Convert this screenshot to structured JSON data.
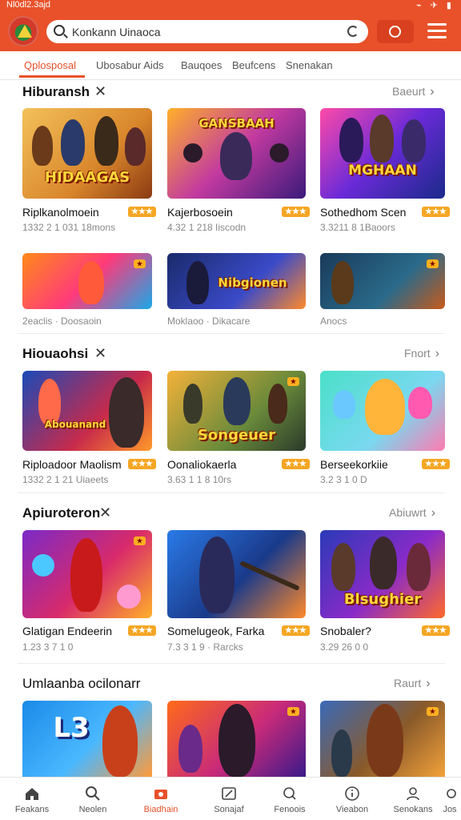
{
  "status": {
    "time": "Nl0dl2.3ajd",
    "icons": "⌁ ✈ ▮"
  },
  "search": {
    "value": "Konkann Uinaoca"
  },
  "tabs": [
    "Qplosposal",
    "Ubosabur Aids",
    "Bauqoes",
    "Beufcens",
    "Snenakan"
  ],
  "sections": [
    {
      "title": "Hiburansh",
      "see_all": "Baeurt",
      "games": [
        {
          "name": "Riplkanolmoein",
          "meta": "1332 2 1 031 18mons",
          "rating": "★★★",
          "art": "HIDAAGAS"
        },
        {
          "name": "Kajerbosoein",
          "meta": "4.32 1 218 Iiscodn",
          "rating": "★★★",
          "art": "GANSBAAH"
        },
        {
          "name": "Sothedhom Scen",
          "meta": "3.3211 8 1Baoors",
          "rating": "★★★",
          "art": "MGHAAN"
        },
        {
          "name": "",
          "meta": "2eaclis · Doosaoin",
          "rating": "",
          "art": ""
        },
        {
          "name": "",
          "meta": "Moklaoo · Dikacare",
          "rating": "",
          "art": "Nibgionen"
        },
        {
          "name": "",
          "meta": "Anocs",
          "rating": "",
          "art": ""
        }
      ]
    },
    {
      "title": "Hiouaohsi",
      "see_all": "Fnort",
      "games": [
        {
          "name": "Riploadoor Maolism",
          "meta": "1332 2 1 21 Uiaeets",
          "rating": "★★★",
          "art": "Abouanand"
        },
        {
          "name": "Oonaliokaerla",
          "meta": "3.63 1 1 8 10rs",
          "rating": "★★★",
          "art": "Songeuer"
        },
        {
          "name": "Berseekorkiie",
          "meta": "3.2 3 1 0 D",
          "rating": "★★★",
          "art": ""
        }
      ]
    },
    {
      "title": "Apiuroteron",
      "see_all": "Abiuwrt",
      "games": [
        {
          "name": "Glatigan Endeerin",
          "meta": "1.23 3 7 1 0",
          "rating": "★★★",
          "art": ""
        },
        {
          "name": "Somelugeok, Farka",
          "meta": "7.3 3 1 9 · Rarcks",
          "rating": "★★★",
          "art": ""
        },
        {
          "name": "Snobaler?",
          "meta": "3.29 26 0 0",
          "rating": "★★★",
          "art": "Blsughier"
        }
      ]
    },
    {
      "title": "Umlaanba ocilonarr",
      "see_all": "Raurt",
      "games": [
        {
          "name": "",
          "meta": "",
          "rating": "",
          "art": "L3"
        },
        {
          "name": "",
          "meta": "",
          "rating": "",
          "art": ""
        },
        {
          "name": "",
          "meta": "",
          "rating": "",
          "art": ""
        }
      ]
    }
  ],
  "bottom_nav": [
    {
      "label": "Feakans",
      "icon": "home-icon"
    },
    {
      "label": "Neolen",
      "icon": "search-icon"
    },
    {
      "label": "Biadhain",
      "icon": "camera-icon"
    },
    {
      "label": "Sonajaf",
      "icon": "edit-icon"
    },
    {
      "label": "Fenoois",
      "icon": "chat-icon"
    },
    {
      "label": "Vieabon",
      "icon": "info-icon"
    },
    {
      "label": "Senokans",
      "icon": "user-icon"
    },
    {
      "label": "Jos",
      "icon": "settings-icon"
    }
  ],
  "colors": {
    "accent": "#e8512a",
    "rating": "#f5a623"
  }
}
